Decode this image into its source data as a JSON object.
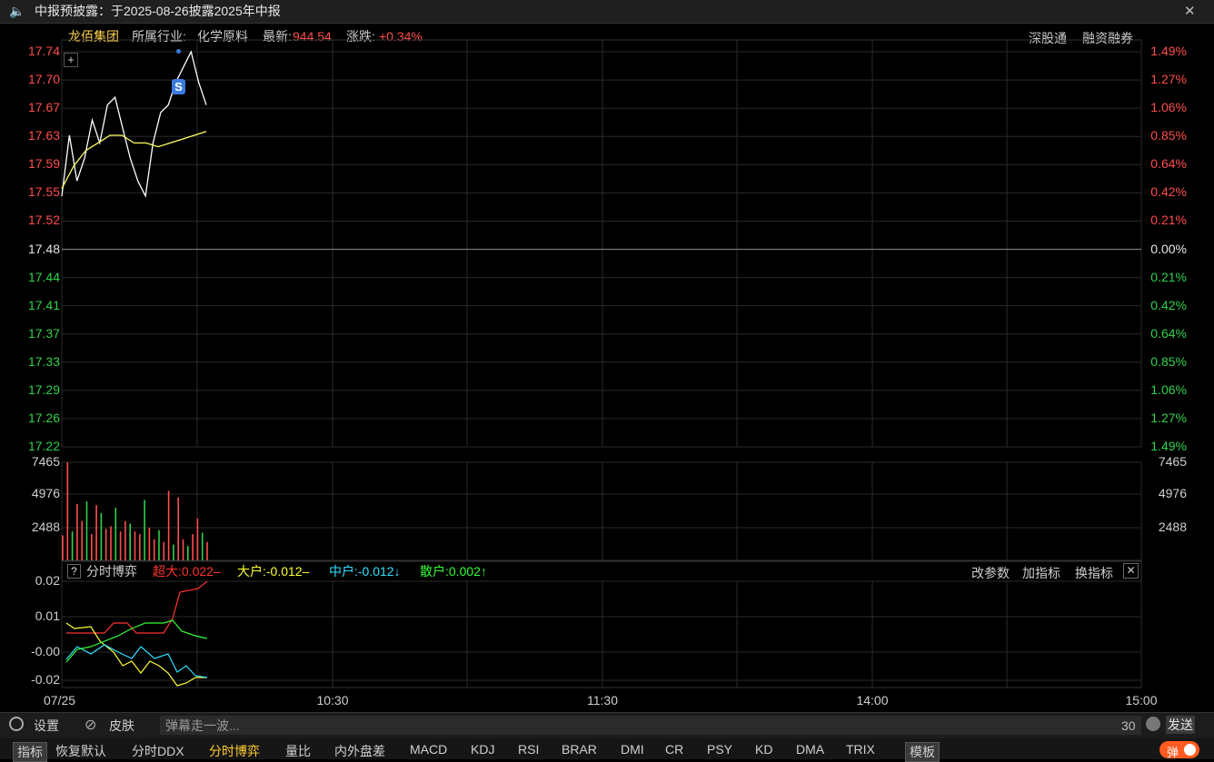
{
  "topbar": {
    "title": "中报预披露：于2025-08-26披露2025年中报",
    "speaker_icon": "speaker-icon",
    "close_icon": "close-icon",
    "close_glyph": "✕"
  },
  "info": {
    "stock_name": "龙佰集团",
    "industry_label": "所属行业:",
    "industry": "化学原料",
    "latest_label": "最新:",
    "latest": "944.54",
    "change_label": "涨跌:",
    "change": "+0.34%",
    "link1": "深股通",
    "link2": "融资融券"
  },
  "price_axis": {
    "left": [
      "17.74",
      "17.70",
      "17.67",
      "17.63",
      "17.59",
      "17.55",
      "17.52",
      "17.48",
      "17.44",
      "17.41",
      "17.37",
      "17.33",
      "17.29",
      "17.26",
      "17.22"
    ],
    "right": [
      "1.49%",
      "1.27%",
      "1.06%",
      "0.85%",
      "0.64%",
      "0.42%",
      "0.21%",
      "0.00%",
      "0.21%",
      "0.42%",
      "0.64%",
      "0.85%",
      "1.06%",
      "1.27%",
      "1.49%"
    ]
  },
  "volume_axis": [
    "7465",
    "4976",
    "2488"
  ],
  "indicator": {
    "help": "?",
    "name": "分时博弈",
    "super": "超大:0.022–",
    "big": "大户:-0.012–",
    "mid": "中户:-0.012↓",
    "retail": "散户:0.002↑",
    "btn_params": "改参数",
    "btn_add": "加指标",
    "btn_switch": "换指标",
    "close": "✕",
    "axis": [
      "0.02",
      "0.01",
      "-0.00",
      "-0.02"
    ]
  },
  "time_axis": [
    "07/25",
    "10:30",
    "11:30",
    "14:00",
    "15:00"
  ],
  "bottom": {
    "settings": "设置",
    "skin": "皮肤",
    "danmu_placeholder": "弹幕走一波...",
    "count": "30",
    "send": "发送"
  },
  "tabs": [
    "指标",
    "恢复默认",
    "分时DDX",
    "分时博弈",
    "量比",
    "内外盘差",
    "MACD",
    "KDJ",
    "RSI",
    "BRAR",
    "DMI",
    "CR",
    "PSY",
    "KD",
    "DMA",
    "TRIX",
    "模板"
  ],
  "active_tab": "分时博弈",
  "toggle_label": "弹",
  "signal_marker": "S",
  "chart_data": [
    {
      "type": "line",
      "series": [
        {
          "name": "price",
          "color": "#ffffff",
          "values": [
            17.55,
            17.63,
            17.57,
            17.6,
            17.65,
            17.62,
            17.67,
            17.68,
            17.64,
            17.6,
            17.57,
            17.55,
            17.62,
            17.66,
            17.67,
            17.7,
            17.72,
            17.74,
            17.7,
            17.67
          ]
        },
        {
          "name": "avg",
          "color": "#ffff66",
          "values": [
            17.56,
            17.59,
            17.61,
            17.62,
            17.63,
            17.63,
            17.62,
            17.62,
            17.615,
            17.62,
            17.625,
            17.63,
            17.635
          ]
        }
      ],
      "ylim": [
        17.22,
        17.74
      ],
      "reference": 17.48
    },
    {
      "type": "bar",
      "values": [
        1900,
        7465,
        2200,
        4300,
        3000,
        4500,
        2000,
        4200,
        3600,
        2400,
        2600,
        4000,
        2200,
        3000,
        2800,
        2200,
        2000,
        4600,
        2500,
        1600,
        2300,
        1400,
        5300,
        1200,
        4800,
        1600,
        1100,
        2000,
        3200,
        2100,
        1400
      ],
      "colors_note": "red up / green down",
      "ylim": [
        0,
        7465
      ]
    },
    {
      "type": "line",
      "series": [
        {
          "name": "超大",
          "color": "#ff3333"
        },
        {
          "name": "大户",
          "color": "#ffff33"
        },
        {
          "name": "中户",
          "color": "#33e0ff"
        },
        {
          "name": "散户",
          "color": "#33ff33"
        }
      ],
      "ylim": [
        -0.02,
        0.02
      ]
    }
  ]
}
